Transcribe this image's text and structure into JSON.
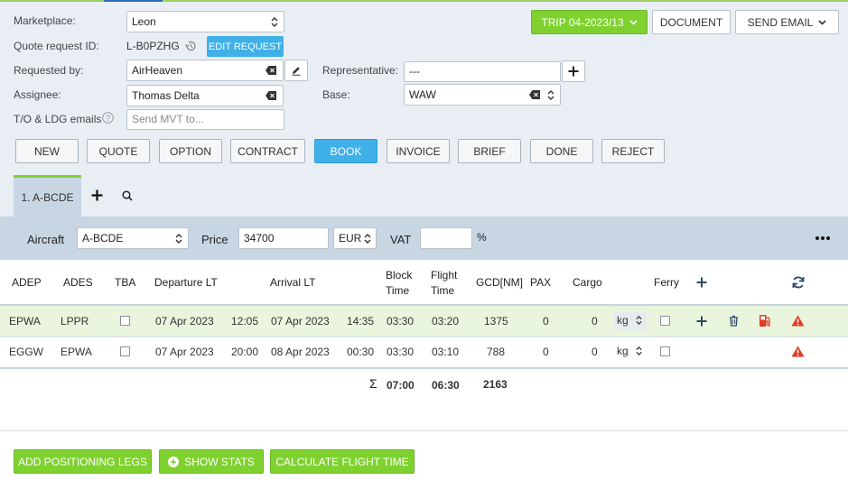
{
  "header": {
    "marketplace_label": "Marketplace:",
    "marketplace_value": "Leon",
    "quote_id_label": "Quote request ID:",
    "quote_id_value": "L-B0PZHG",
    "edit_request_label": "EDIT REQUEST",
    "requested_by_label": "Requested by:",
    "requested_by_value": "AirHeaven",
    "representative_label": "Representative:",
    "representative_value": "---",
    "assignee_label": "Assignee:",
    "assignee_value": "Thomas Delta",
    "base_label": "Base:",
    "base_value": "WAW",
    "emails_label": "T/O & LDG emails",
    "emails_placeholder": "Send MVT to..."
  },
  "actions": {
    "trip_label": "TRIP 04-2023/13",
    "document_label": "DOCUMENT",
    "send_email_label": "SEND EMAIL"
  },
  "status_buttons": [
    {
      "label": "NEW",
      "active": false
    },
    {
      "label": "QUOTE",
      "active": false
    },
    {
      "label": "OPTION",
      "active": false
    },
    {
      "label": "CONTRACT",
      "active": false
    },
    {
      "label": "BOOK",
      "active": true
    },
    {
      "label": "INVOICE",
      "active": false
    },
    {
      "label": "BRIEF",
      "active": false
    },
    {
      "label": "DONE",
      "active": false
    },
    {
      "label": "REJECT",
      "active": false
    }
  ],
  "tabs": [
    {
      "label": "1. A-BCDE"
    }
  ],
  "aircraft_bar": {
    "aircraft_label": "Aircraft",
    "aircraft_value": "A-BCDE",
    "price_label": "Price",
    "price_value": "34700",
    "currency_value": "EUR",
    "vat_label": "VAT",
    "vat_value": "",
    "percent_label": "%"
  },
  "table": {
    "headers": {
      "adep": "ADEP",
      "ades": "ADES",
      "tba": "TBA",
      "departure": "Departure LT",
      "arrival": "Arrival LT",
      "block_time_1": "Block",
      "block_time_2": "Time",
      "flight_time_1": "Flight",
      "flight_time_2": "Time",
      "gcd": "GCD[NM]",
      "pax": "PAX",
      "cargo": "Cargo",
      "ferry": "Ferry"
    },
    "rows": [
      {
        "adep": "EPWA",
        "ades": "LPPR",
        "dep_date": "07 Apr 2023",
        "dep_time": "12:05",
        "arr_date": "07 Apr 2023",
        "arr_time": "14:35",
        "block": "03:30",
        "flight": "03:20",
        "gcd": "1375",
        "pax": "0",
        "cargo": "0",
        "unit": "kg"
      },
      {
        "adep": "EGGW",
        "ades": "EPWA",
        "dep_date": "07 Apr 2023",
        "dep_time": "20:00",
        "arr_date": "08 Apr 2023",
        "arr_time": "00:30",
        "block": "03:30",
        "flight": "03:10",
        "gcd": "788",
        "pax": "0",
        "cargo": "0",
        "unit": "kg"
      }
    ],
    "totals": {
      "sigma": "Σ",
      "block": "07:00",
      "flight": "06:30",
      "gcd": "2163"
    }
  },
  "footer": {
    "positioning_label": "ADD POSITIONING LEGS",
    "stats_label": "SHOW STATS",
    "calc_label": "CALCULATE FLIGHT TIME"
  },
  "colors": {
    "accent_green": "#7fd12f",
    "accent_blue": "#3fb0e8",
    "panel": "#c8d6e4",
    "warning_red": "#e03b24"
  }
}
